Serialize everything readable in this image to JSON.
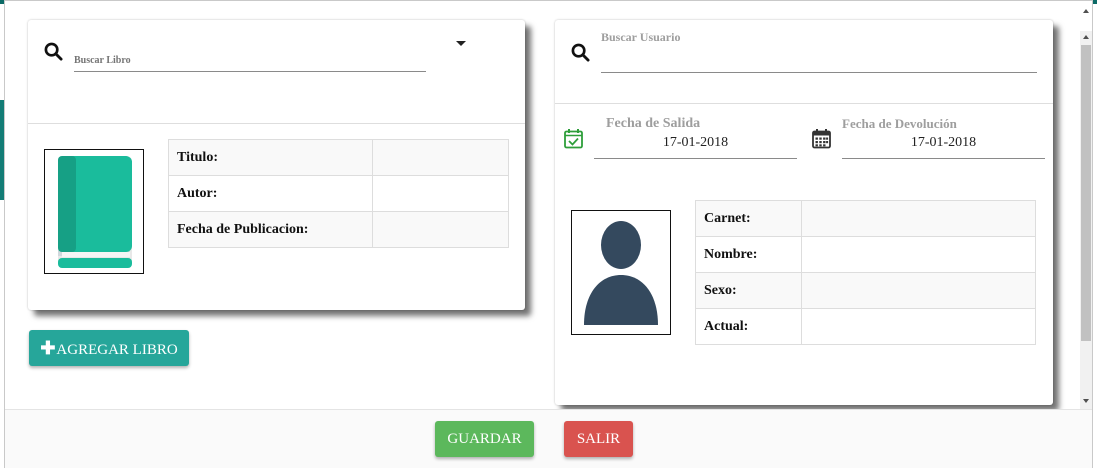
{
  "book_search": {
    "placeholder": "Buscar Libro",
    "icon": "search-icon"
  },
  "book_table": [
    {
      "label": "Titulo:",
      "value": ""
    },
    {
      "label": "Autor:",
      "value": ""
    },
    {
      "label": "Fecha de Publicacion:",
      "value": ""
    }
  ],
  "add_book": {
    "plus": "✚",
    "label": "AGREGAR LIBRO"
  },
  "user_search": {
    "label": "Buscar Usuario",
    "value": "",
    "icon": "search-icon"
  },
  "dates": {
    "salida_label": "Fecha de Salida",
    "salida_value": "17-01-2018",
    "devolucion_label": "Fecha de Devolución",
    "devolucion_value": "17-01-2018"
  },
  "user_table": [
    {
      "label": "Carnet:",
      "value": ""
    },
    {
      "label": "Nombre:",
      "value": ""
    },
    {
      "label": "Sexo:",
      "value": ""
    },
    {
      "label": "Actual:",
      "value": ""
    }
  ],
  "footer": {
    "save_label": "GUARDAR",
    "exit_label": "SALIR"
  },
  "colors": {
    "teal": "#26a69a",
    "save_green": "#5cb85c",
    "exit_red": "#d9534f",
    "calendar_green": "#2e9e3a",
    "book_green": "#1abc9c",
    "avatar_dark": "#34495e"
  }
}
